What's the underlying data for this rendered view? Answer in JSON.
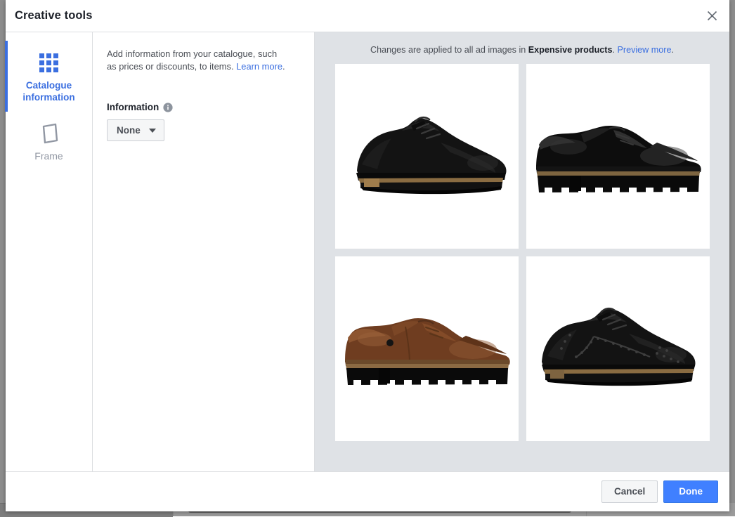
{
  "dialog": {
    "title": "Creative tools",
    "close_icon": "close-icon"
  },
  "rail": {
    "items": [
      {
        "id": "catalogue-information",
        "label": "Catalogue information",
        "icon": "grid-icon",
        "active": true
      },
      {
        "id": "frame",
        "label": "Frame",
        "icon": "frame-icon",
        "active": false
      }
    ]
  },
  "settings": {
    "description_text": "Add information from your catalogue, such as prices or discounts, to items. ",
    "description_link": "Learn more",
    "description_end": ".",
    "field": {
      "label": "Information",
      "info_icon": "info-icon",
      "selected_value": "None",
      "options": [
        "None"
      ]
    }
  },
  "preview": {
    "notice_prefix": "Changes are applied to all ad images in ",
    "notice_bold": "Expensive products",
    "notice_mid": ". ",
    "notice_link": "Preview more",
    "notice_end": ".",
    "images": [
      {
        "alt": "black cap-toe leather dress shoe",
        "variant": "black-captoe"
      },
      {
        "alt": "glossy black moc-toe shoe with lug sole",
        "variant": "black-moc"
      },
      {
        "alt": "brown leather moc-toe shoe with black lug sole",
        "variant": "brown-moc"
      },
      {
        "alt": "black leather wingtip brogue shoe",
        "variant": "black-wingtip"
      }
    ]
  },
  "footer": {
    "cancel_label": "Cancel",
    "done_label": "Done"
  },
  "colors": {
    "accent_blue": "#3b6fe0",
    "primary_button": "#4080ff",
    "preview_background": "#dfe2e6",
    "text_primary": "#1d2129",
    "text_secondary": "#4b4f56",
    "text_muted": "#9197a3"
  }
}
